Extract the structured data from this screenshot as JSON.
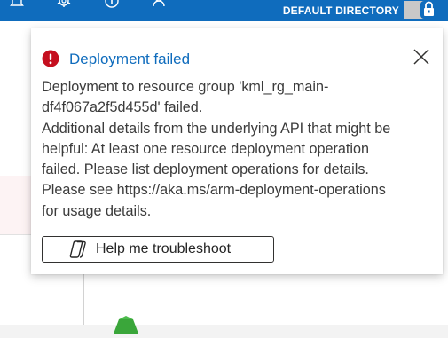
{
  "topbar": {
    "directory_label": "DEFAULT DIRECTORY",
    "background_color": "#0f6cbd",
    "icons": [
      "bell-icon",
      "settings-gear-icon",
      "help-icon",
      "feedback-person-icon",
      "account-avatar-icon",
      "lock-icon"
    ]
  },
  "notification": {
    "status": "error",
    "status_color": "#c50f1f",
    "title_color": "#0f6cbd",
    "title": "Deployment failed",
    "body_lines": [
      "Deployment to resource group 'kml_rg_main-",
      "df4f067a2f5d455d' failed.",
      "Additional details from the underlying API that might be",
      "helpful: At least one resource deployment operation",
      "failed. Please list deployment operations for details.",
      "Please see https://aka.ms/arm-deployment-operations",
      "for usage details."
    ],
    "help_button_label": "Help me troubleshoot",
    "help_button_icon": "copilot-icon",
    "close_icon": "close-icon"
  }
}
